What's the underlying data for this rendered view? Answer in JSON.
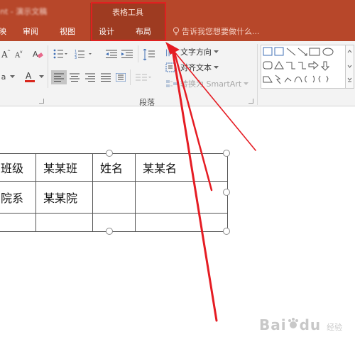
{
  "titlebar": {
    "app_title": "nt - 演示文稿",
    "context_title": "表格工具"
  },
  "tabs": [
    {
      "label": "映"
    },
    {
      "label": "审阅"
    },
    {
      "label": "视图"
    },
    {
      "label": "设计"
    },
    {
      "label": "布局"
    }
  ],
  "tell_me": "告诉我您想要做什么...",
  "ribbon": {
    "text_direction": "文字方向",
    "align_text": "对齐文本",
    "convert_smartart": "转换为 SmartArt",
    "font_size_label": "a",
    "paragraph_group": "段落"
  },
  "table": {
    "rows": [
      [
        "班级",
        "某某班",
        "姓名",
        "某某名"
      ],
      [
        "院系",
        "某某院",
        "",
        ""
      ],
      [
        "",
        "",
        "",
        ""
      ]
    ]
  },
  "watermark": {
    "brand": "Bai",
    "paw": "du",
    "suffix": "经验"
  },
  "colors": {
    "tab_band": "#b7472a",
    "context_group": "#9e3b21",
    "highlight_box": "#e02020",
    "annotation_arrow": "#e51c23"
  }
}
